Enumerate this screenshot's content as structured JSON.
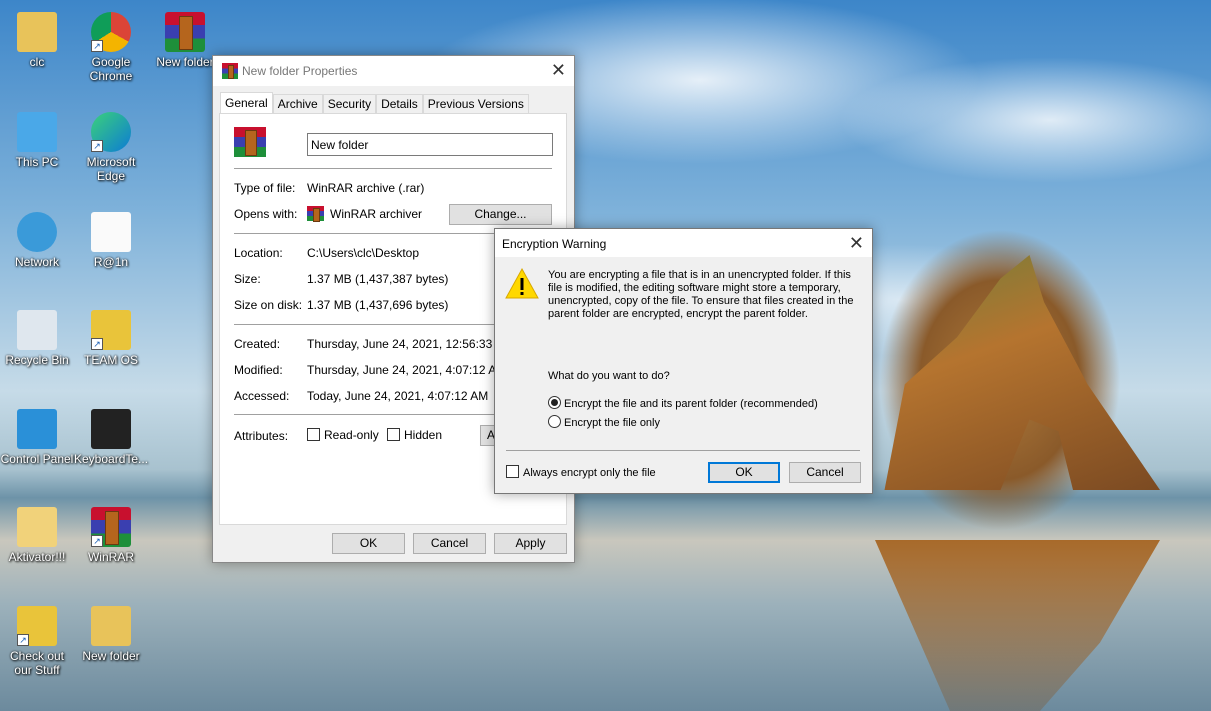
{
  "desktop": {
    "icons": [
      {
        "label": "clc",
        "icon": "user-folder-icon"
      },
      {
        "label": "Google Chrome",
        "icon": "chrome-icon"
      },
      {
        "label": "New folder",
        "icon": "winrar-archive-icon"
      },
      {
        "label": "This PC",
        "icon": "computer-icon"
      },
      {
        "label": "Microsoft Edge",
        "icon": "edge-icon"
      },
      {
        "label": "Network",
        "icon": "network-icon"
      },
      {
        "label": "R@1n",
        "icon": "text-file-icon"
      },
      {
        "label": "Recycle Bin",
        "icon": "recycle-bin-icon"
      },
      {
        "label": "TEAM OS",
        "icon": "globe-shortcut-icon"
      },
      {
        "label": "Control Panel",
        "icon": "control-panel-icon"
      },
      {
        "label": "KeyboardTe...",
        "icon": "app-window-icon"
      },
      {
        "label": "Aktivator!!!",
        "icon": "folder-icon"
      },
      {
        "label": "WinRAR",
        "icon": "winrar-icon"
      },
      {
        "label": "Check out our Stuff",
        "icon": "globe-shortcut-icon"
      },
      {
        "label": "New folder",
        "icon": "photo-folder-icon"
      }
    ]
  },
  "properties": {
    "title": "New folder Properties",
    "tabs": [
      "General",
      "Archive",
      "Security",
      "Details",
      "Previous Versions"
    ],
    "name_value": "New folder",
    "type_label": "Type of file:",
    "type_value": "WinRAR archive (.rar)",
    "opens_label": "Opens with:",
    "opens_value": "WinRAR archiver",
    "change_label": "Change...",
    "location_label": "Location:",
    "location_value": "C:\\Users\\clc\\Desktop",
    "size_label": "Size:",
    "size_value": "1.37 MB (1,437,387 bytes)",
    "disk_label": "Size on disk:",
    "disk_value": "1.37 MB (1,437,696 bytes)",
    "created_label": "Created:",
    "created_value": "Thursday, June 24, 2021, 12:56:33 AM",
    "modified_label": "Modified:",
    "modified_value": "Thursday, June 24, 2021, 4:07:12 AM",
    "accessed_label": "Accessed:",
    "accessed_value": "Today, June 24, 2021, 4:07:12 AM",
    "attributes_label": "Attributes:",
    "readonly_label": "Read-only",
    "hidden_label": "Hidden",
    "advanced_label": "A",
    "ok": "OK",
    "cancel": "Cancel",
    "apply": "Apply"
  },
  "warning": {
    "title": "Encryption Warning",
    "message": "You are encrypting a file that is in an unencrypted folder. If this file is modified, the editing software might store a temporary, unencrypted, copy of the file. To ensure that files created in the parent folder are encrypted, encrypt the parent folder.",
    "question": "What do you want to do?",
    "option1": "Encrypt the file and its parent folder (recommended)",
    "option2": "Encrypt the file only",
    "selected": "option1",
    "always_label": "Always encrypt only the file",
    "ok": "OK",
    "cancel": "Cancel"
  }
}
